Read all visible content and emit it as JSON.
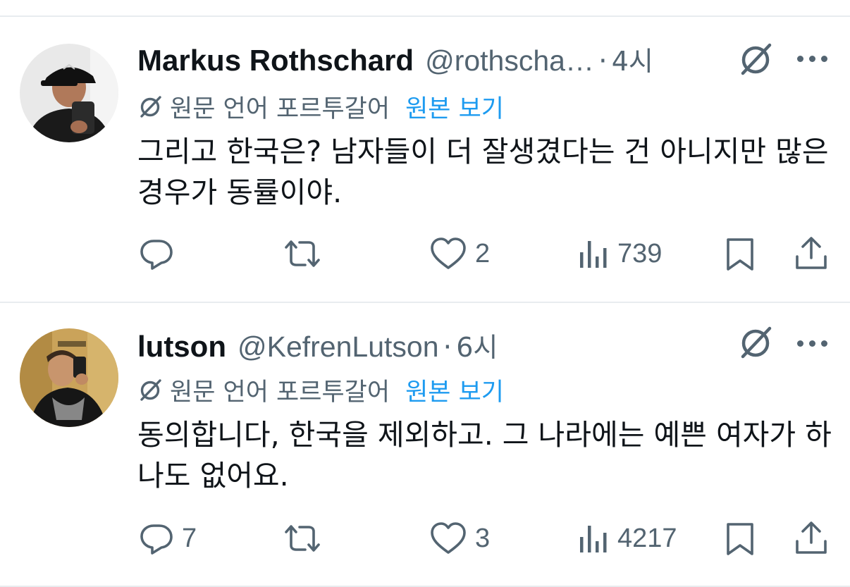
{
  "tweets": [
    {
      "author_name": "Markus Rothschard",
      "handle": "@rothscha…",
      "dot": "·",
      "time": "4시",
      "translated_from": "원문 언어 포르투갈어",
      "show_original": "원본 보기",
      "text": "그리고 한국은? 남자들이 더 잘생겼다는 건 아니지만 많은 경우가 동률이야.",
      "replies": "",
      "reposts": "",
      "likes": "2",
      "views": "739"
    },
    {
      "author_name": "lutson",
      "handle": "@KefrenLutson",
      "dot": "·",
      "time": "6시",
      "translated_from": "원문 언어 포르투갈어",
      "show_original": "원본 보기",
      "text": "동의합니다, 한국을 제외하고. 그 나라에는 예쁜 여자가 하나도 없어요.",
      "replies": "7",
      "reposts": "",
      "likes": "3",
      "views": "4217"
    }
  ],
  "icons": {
    "reply": "reply-icon",
    "repost": "repost-icon",
    "like": "heart-icon",
    "views": "views-icon",
    "bookmark": "bookmark-icon",
    "share": "share-icon",
    "grok": "grok-icon",
    "more": "more-icon",
    "translate": "translate-icon"
  },
  "colors": {
    "text": "#0f1419",
    "secondary": "#536471",
    "link": "#1d9bf0",
    "divider": "#e8ecef"
  }
}
